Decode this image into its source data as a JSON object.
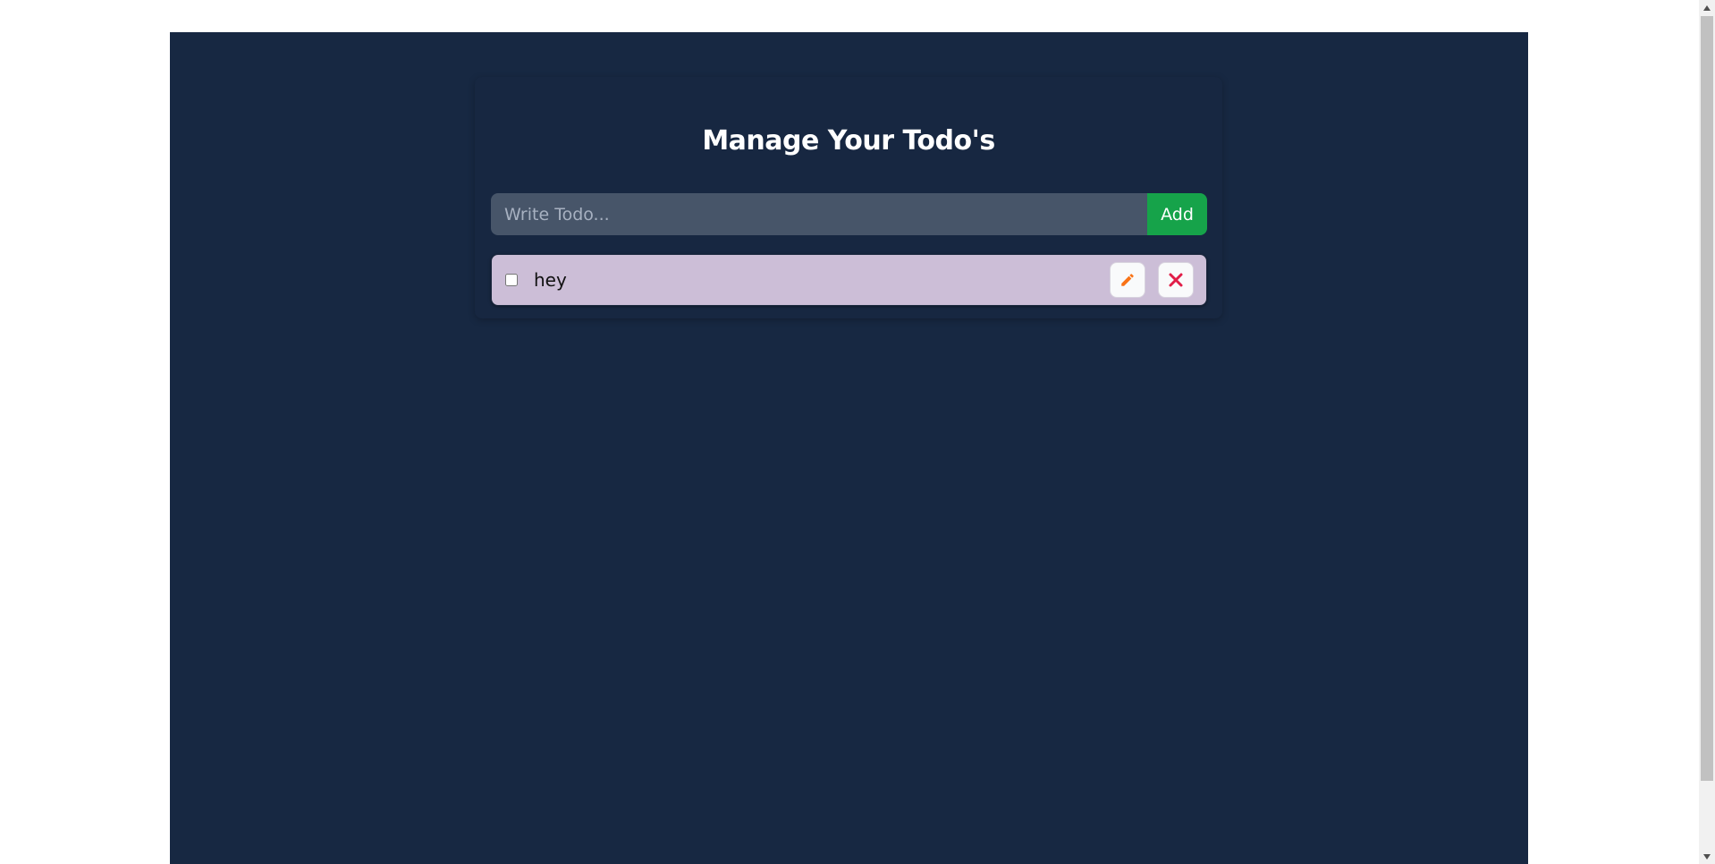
{
  "header": {
    "title": "Manage Your Todo's"
  },
  "form": {
    "input_value": "",
    "input_placeholder": "Write Todo...",
    "add_label": "Add"
  },
  "todos": [
    {
      "text": "hey",
      "completed": false,
      "edit_icon": "pencil-icon",
      "delete_icon": "close-icon"
    }
  ],
  "colors": {
    "page_background": "#172842",
    "input_background": "#475569",
    "add_button": "#16a34a",
    "todo_item_background": "#ccbed7",
    "edit_icon": "#f97316",
    "delete_icon": "#e11d48"
  }
}
